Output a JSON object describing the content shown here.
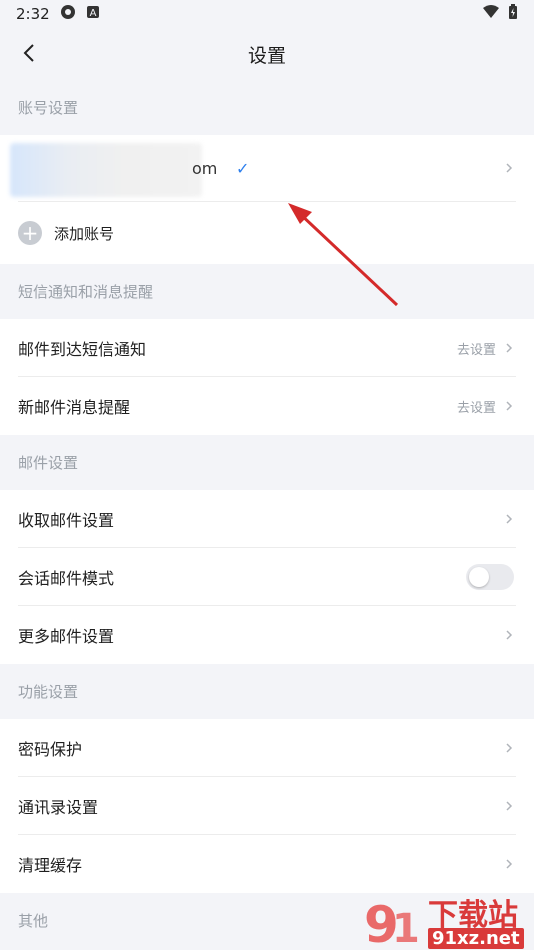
{
  "status_bar": {
    "time": "2:32",
    "icons": [
      "chrome-icon",
      "a-badge-icon",
      "wifi-icon",
      "battery-icon"
    ]
  },
  "header": {
    "title": "设置"
  },
  "sections": {
    "account": {
      "title": "账号设置",
      "account_suffix": "om",
      "add_label": "添加账号"
    },
    "sms": {
      "title": "短信通知和消息提醒",
      "rows": [
        {
          "label": "邮件到达短信通知",
          "hint": "去设置"
        },
        {
          "label": "新邮件消息提醒",
          "hint": "去设置"
        }
      ]
    },
    "mail": {
      "title": "邮件设置",
      "rows": [
        {
          "label": "收取邮件设置"
        },
        {
          "label": "会话邮件模式",
          "toggle": false
        },
        {
          "label": "更多邮件设置"
        }
      ]
    },
    "features": {
      "title": "功能设置",
      "rows": [
        {
          "label": "密码保护"
        },
        {
          "label": "通讯录设置"
        },
        {
          "label": "清理缓存"
        }
      ]
    },
    "other": {
      "title": "其他"
    }
  },
  "watermark": {
    "text1": "下载站",
    "text2": "91xz.net"
  },
  "colors": {
    "accent": "#2f80ed",
    "arrow": "#d42a2a",
    "bg": "#f3f4f8"
  }
}
